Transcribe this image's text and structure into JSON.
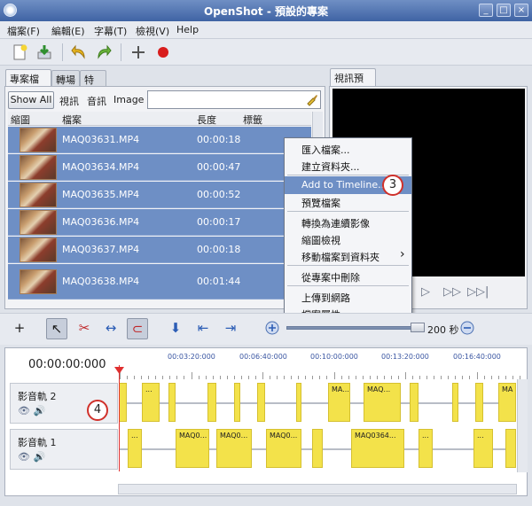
{
  "window": {
    "title": "OpenShot - 預設的專案"
  },
  "menubar": {
    "items": [
      "檔案(F)",
      "編輯(E)",
      "字幕(T)",
      "檢視(V)",
      "Help"
    ]
  },
  "left_tabs": [
    "專案檔案",
    "轉場",
    "特效"
  ],
  "filters": {
    "show_all": "Show All",
    "video": "視訊",
    "audio": "音訊",
    "image": "Image",
    "search_value": ""
  },
  "columns": [
    "縮圖",
    "檔案",
    "長度",
    "標籤"
  ],
  "files": [
    {
      "name": "MAQ03631.MP4",
      "length": "00:00:18"
    },
    {
      "name": "MAQ03634.MP4",
      "length": "00:00:47"
    },
    {
      "name": "MAQ03635.MP4",
      "length": "00:00:52"
    },
    {
      "name": "MAQ03636.MP4",
      "length": "00:00:17"
    },
    {
      "name": "MAQ03637.MP4",
      "length": "00:00:18"
    },
    {
      "name": "MAQ03638.MP4",
      "length": "00:01:44"
    }
  ],
  "preview_tab": "視訊預覽",
  "context_menu": {
    "items": [
      "匯入檔案...",
      "建立資料夾...",
      "Add to Timeline...",
      "預覽檔案",
      "轉換為連續影像",
      "縮圖檢視",
      "移動檔案到資料夾",
      "從專案中刪除",
      "上傳到網路",
      "檔案屬性"
    ],
    "highlighted": "Add to Timeline...",
    "submenu_arrow": "›"
  },
  "callouts": {
    "menu": "3",
    "timeline": "4"
  },
  "zoom": {
    "label": "200 秒"
  },
  "timeline": {
    "timecode": "00:00:00:000",
    "ruler_labels": [
      "00:03:20:000",
      "00:06:40:000",
      "00:10:00:000",
      "00:13:20:000",
      "00:16:40:000"
    ],
    "tracks": [
      {
        "name": "影音軌 2",
        "clips": [
          "...",
          "MA...",
          "MAQ...",
          "MA"
        ]
      },
      {
        "name": "影音軌 1",
        "clips": [
          "...",
          "MAQ0...",
          "MAQ0...",
          "MAQ0...",
          "MAQ0364...",
          "...",
          "..."
        ]
      }
    ],
    "track_icons": "👁 🔊"
  },
  "colors": {
    "selection": "#6e8fc5",
    "clip": "#f3e24a",
    "callout_ring": "#d0302a",
    "playhead": "#e03030"
  }
}
